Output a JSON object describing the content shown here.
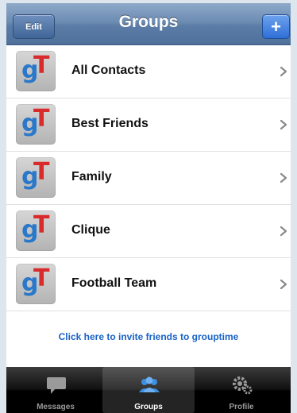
{
  "navbar": {
    "title": "Groups",
    "edit_label": "Edit",
    "add_label": "+"
  },
  "list": {
    "items": [
      {
        "label": "All Contacts",
        "icon": "grouptime-logo"
      },
      {
        "label": "Best Friends",
        "icon": "grouptime-logo"
      },
      {
        "label": "Family",
        "icon": "grouptime-logo"
      },
      {
        "label": "Clique",
        "icon": "grouptime-logo"
      },
      {
        "label": "Football Team",
        "icon": "grouptime-logo"
      }
    ],
    "logo_letters": {
      "g": "g",
      "t": "T"
    },
    "invite_text": "Click here to invite friends to grouptime"
  },
  "tabbar": {
    "tabs": [
      {
        "label": "Messages",
        "icon": "speech-bubble-icon",
        "selected": false
      },
      {
        "label": "Groups",
        "icon": "people-icon",
        "selected": true
      },
      {
        "label": "Profile",
        "icon": "gears-icon",
        "selected": false
      }
    ]
  },
  "colors": {
    "navbar": "#5b7ca6",
    "add_button": "#2f6fd6",
    "link": "#1a63c6",
    "logo_blue": "#2a78c9",
    "logo_red": "#d92b2b",
    "tabbar": "#000000"
  }
}
